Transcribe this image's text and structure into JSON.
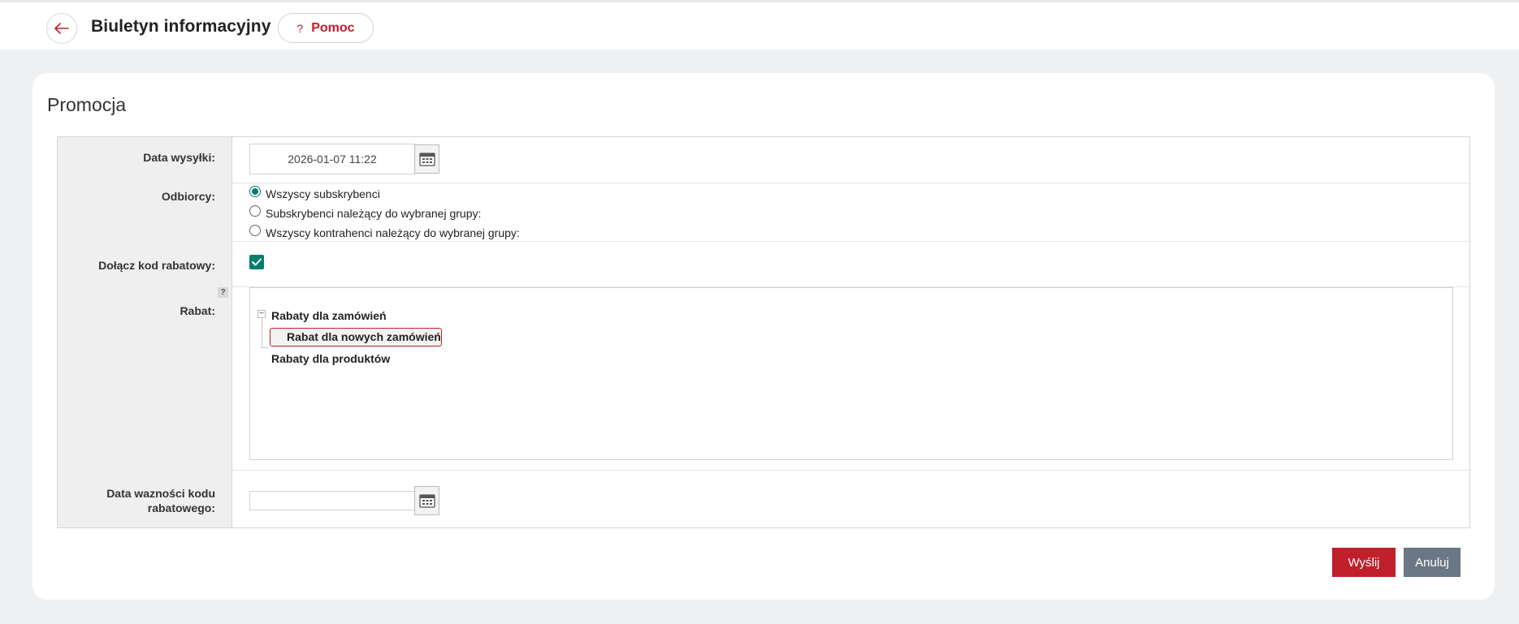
{
  "header": {
    "title": "Biuletyn informacyjny",
    "help_label": "Pomoc",
    "help_icon": "?"
  },
  "section": {
    "title": "Promocja"
  },
  "form": {
    "send_date": {
      "label": "Data wysyłki:",
      "value": "2026-01-07 11:22"
    },
    "recipients": {
      "label": "Odbiorcy:",
      "options": [
        {
          "label": "Wszyscy subskrybenci",
          "checked": true
        },
        {
          "label": "Subskrybenci należący do wybranej grupy:",
          "checked": false
        },
        {
          "label": "Wszyscy kontrahenci należący do wybranej grupy:",
          "checked": false
        }
      ]
    },
    "discount_code": {
      "label": "Dołącz kod rabatowy:",
      "checked": true
    },
    "discount": {
      "label": "Rabat:",
      "help_mark": "?",
      "tree": {
        "toggle": "−",
        "group_orders": "Rabaty dla zamówień",
        "selected_item": "Rabat dla nowych zamówień",
        "group_products": "Rabaty dla produktów"
      }
    },
    "expiry_date": {
      "label": "Data ważności kodu rabatowego:",
      "label_line1": "Data wazności kodu",
      "label_line2": "rabatowego:",
      "value": ""
    }
  },
  "buttons": {
    "send": "Wyślij",
    "cancel": "Anuluj"
  },
  "colors": {
    "accent_red": "#c0202b",
    "accent_teal": "#0a7d6e",
    "cancel_gray": "#6c7785"
  }
}
